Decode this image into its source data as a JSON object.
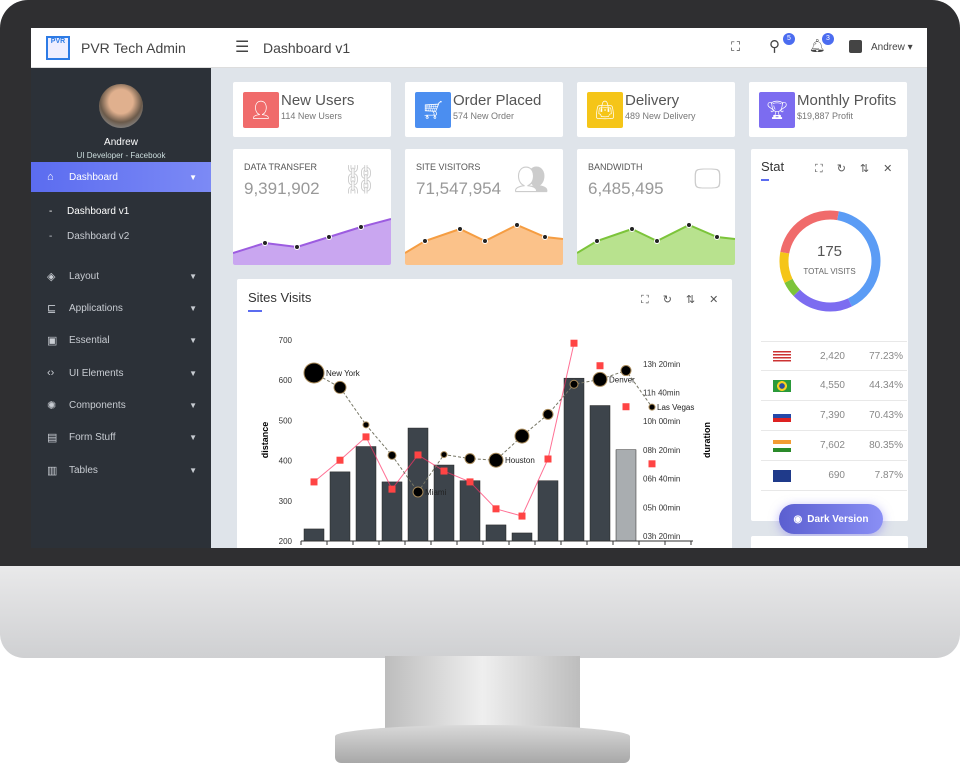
{
  "app": {
    "title": "PVR Tech Admin",
    "logo_text": "PVR",
    "page_title": "Dashboard v1",
    "user": "Andrew",
    "search_badge": "5",
    "bell_badge": "3"
  },
  "profile": {
    "name": "Andrew",
    "role": "UI Developer - Facebook"
  },
  "sidebar": {
    "items": [
      {
        "label": "Dashboard",
        "icon": "home-icon",
        "active": true
      },
      {
        "label": "Dashboard v1",
        "sub": true
      },
      {
        "label": "Dashboard v2",
        "sub": true
      },
      {
        "label": "Layout",
        "icon": "layers-icon"
      },
      {
        "label": "Applications",
        "icon": "apps-icon"
      },
      {
        "label": "Essential",
        "icon": "essential-icon"
      },
      {
        "label": "UI Elements",
        "icon": "code-icon"
      },
      {
        "label": "Components",
        "icon": "components-icon"
      },
      {
        "label": "Form Stuff",
        "icon": "form-icon"
      },
      {
        "label": "Tables",
        "icon": "table-icon"
      }
    ]
  },
  "info_cards": [
    {
      "title": "New Users",
      "sub": "114 New Users",
      "color": "#f06b6b",
      "icon": "users-icon"
    },
    {
      "title": "Order Placed",
      "sub": "574 New Order",
      "color": "#4b8ef0",
      "icon": "cart-icon"
    },
    {
      "title": "Delivery",
      "sub": "489 New Delivery",
      "color": "#f5c518",
      "icon": "bag-icon"
    },
    {
      "title": "Monthly Profits",
      "sub": "$19,887 Profit",
      "color": "#7c6cf0",
      "icon": "trophy-icon"
    }
  ],
  "stat_cards": [
    {
      "label": "DATA TRANSFER",
      "value": "9,391,902",
      "color": "#9c5ce0",
      "fill": "#c9a6f0",
      "icon": "link-icon"
    },
    {
      "label": "SITE VISITORS",
      "value": "71,547,954",
      "color": "#f59d42",
      "fill": "#fbc28a",
      "icon": "people-icon"
    },
    {
      "label": "BANDWIDTH",
      "value": "6,485,495",
      "color": "#7cc43a",
      "fill": "#b8e28e",
      "icon": "monitor-icon"
    }
  ],
  "stat_panel": {
    "title": "Stat",
    "total": "175",
    "total_label": "TOTAL VISITS",
    "rows": [
      {
        "country": "United States",
        "flag": "us-flag",
        "visits": "2,420",
        "pct": "77.23%"
      },
      {
        "country": "Brazil",
        "flag": "br-flag",
        "visits": "4,550",
        "pct": "44.34%"
      },
      {
        "country": "Russia",
        "flag": "ru-flag",
        "visits": "7,390",
        "pct": "70.43%"
      },
      {
        "country": "India",
        "flag": "in-flag",
        "visits": "7,602",
        "pct": "80.35%"
      },
      {
        "country": "Australia",
        "flag": "au-flag",
        "visits": "690",
        "pct": "7.87%"
      }
    ],
    "donut_colors": [
      "#5b9cf5",
      "#7c6cf0",
      "#7cc43a",
      "#f5c518",
      "#f06b6b"
    ]
  },
  "dark_button": "Dark Version",
  "chart_data": {
    "title": "Sites Visits",
    "type": "bar",
    "ylabel": "distance",
    "y2label": "duration",
    "ylim": [
      200,
      700
    ],
    "yticks": [
      "200",
      "300",
      "400",
      "500",
      "600",
      "700"
    ],
    "y2ticks": [
      "03h 20min",
      "05h 00min",
      "06h 40min",
      "08h 20min",
      "10h 00min",
      "11h 40min",
      "13h 20min"
    ],
    "bars": [
      230,
      372,
      435,
      347,
      481,
      389,
      350,
      240,
      220,
      350,
      605,
      537,
      427
    ],
    "highlight_bar_color": "#a9adb0",
    "bar_color": "#3d444b",
    "red_series": [
      347,
      401,
      459,
      329,
      414,
      374,
      347,
      280,
      262,
      404,
      692,
      636,
      534,
      392
    ],
    "bubbles": [
      618,
      582,
      489,
      413,
      322,
      415,
      405,
      401,
      461,
      515,
      590,
      602,
      624,
      533
    ],
    "bubble_sizes": [
      10,
      6,
      3,
      4,
      5,
      3,
      5,
      7,
      7,
      5,
      4,
      7,
      5,
      3
    ],
    "bubble_labels": [
      "New York",
      "",
      "",
      "",
      "Miami",
      "",
      "",
      "Houston",
      "",
      "",
      "",
      "Denver",
      "",
      "Las Vegas"
    ]
  }
}
